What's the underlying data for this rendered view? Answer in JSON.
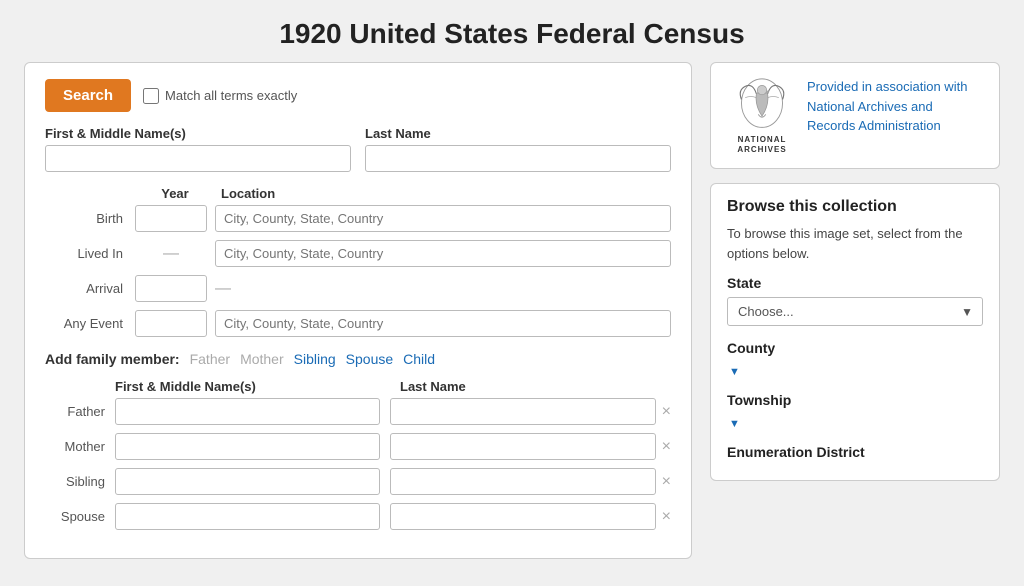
{
  "page": {
    "title": "1920 United States Federal Census"
  },
  "search": {
    "button_label": "Search",
    "match_label": "Match all terms exactly"
  },
  "form": {
    "first_name_label": "First & Middle Name(s)",
    "last_name_label": "Last Name",
    "year_header": "Year",
    "location_header": "Location",
    "events": [
      {
        "label": "Birth",
        "has_year_input": true,
        "has_location_input": true,
        "location_placeholder": "City, County, State, Country"
      },
      {
        "label": "Lived In",
        "has_year_input": false,
        "has_location_input": true,
        "location_placeholder": "City, County, State, Country"
      },
      {
        "label": "Arrival",
        "has_year_input": true,
        "has_location_input": false,
        "location_placeholder": ""
      },
      {
        "label": "Any Event",
        "has_year_input": true,
        "has_location_input": true,
        "location_placeholder": "City, County, State, Country"
      }
    ],
    "add_family_label": "Add family member:",
    "family_links": [
      {
        "label": "Father",
        "active": false
      },
      {
        "label": "Mother",
        "active": false
      },
      {
        "label": "Sibling",
        "active": true
      },
      {
        "label": "Spouse",
        "active": true
      },
      {
        "label": "Child",
        "active": true
      }
    ],
    "family_first_header": "First & Middle Name(s)",
    "family_last_header": "Last Name",
    "family_members": [
      {
        "label": "Father"
      },
      {
        "label": "Mother"
      },
      {
        "label": "Sibling"
      },
      {
        "label": "Spouse"
      }
    ]
  },
  "archives": {
    "logo_line1": "NATIONAL",
    "logo_line2": "ARCHIVES",
    "description": "Provided in association with National Archives and Records Administration"
  },
  "browse": {
    "title": "Browse this collection",
    "description": "To browse this image set, select from the options below.",
    "state_label": "State",
    "state_placeholder": "Choose...",
    "county_label": "County",
    "township_label": "Township",
    "enumeration_label": "Enumeration District"
  }
}
